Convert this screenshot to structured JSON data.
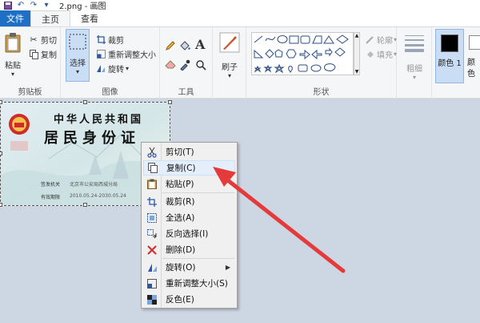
{
  "window": {
    "title": "2.png - 画图"
  },
  "tabs": {
    "file": "文件",
    "home": "主页",
    "view": "查看"
  },
  "ribbon": {
    "clipboard": {
      "label": "剪贴板",
      "paste": "粘贴",
      "cut": "剪切",
      "copy": "复制"
    },
    "image": {
      "label": "图像",
      "select_top": "选择",
      "crop": "裁剪",
      "resize": "重新调整大小",
      "rotate": "旋转"
    },
    "tools": {
      "label": "工具",
      "text_icon": "A"
    },
    "brush": {
      "label": "刷子"
    },
    "shapes": {
      "label": "形状",
      "outline": "轮廓",
      "fill": "填充"
    },
    "size": {
      "label": "粗细"
    },
    "color1": {
      "label": "颜色 1",
      "value": "#000000"
    },
    "color2": {
      "label": "颜色"
    }
  },
  "idcard": {
    "title_line1": "中华人民共和国",
    "title_line2": "居民身份证",
    "field1_label": "签发机关",
    "field1_value": "北京市公安局西城分局",
    "field2_label": "有效期限",
    "field2_value": "2010.05.24-2030.05.24"
  },
  "context_menu": {
    "items": [
      {
        "label": "剪切(T)",
        "icon": "scissors-icon"
      },
      {
        "label": "复制(C)",
        "icon": "copy-icon"
      },
      {
        "label": "粘贴(P)",
        "icon": "paste-icon"
      },
      {
        "label": "裁剪(R)",
        "icon": "crop-icon"
      },
      {
        "label": "全选(A)",
        "icon": "select-all-icon"
      },
      {
        "label": "反向选择(I)",
        "icon": "invert-selection-icon"
      },
      {
        "label": "删除(D)",
        "icon": "delete-icon"
      },
      {
        "label": "旋转(O)",
        "icon": "rotate-icon"
      },
      {
        "label": "重新调整大小(S)",
        "icon": "resize-icon"
      },
      {
        "label": "反色(E)",
        "icon": "invert-color-icon"
      }
    ]
  },
  "colors": {
    "file_tab": "#1f6fc4",
    "arrow": "#e53a3a",
    "canvas_bg": "#cdd6e3"
  }
}
